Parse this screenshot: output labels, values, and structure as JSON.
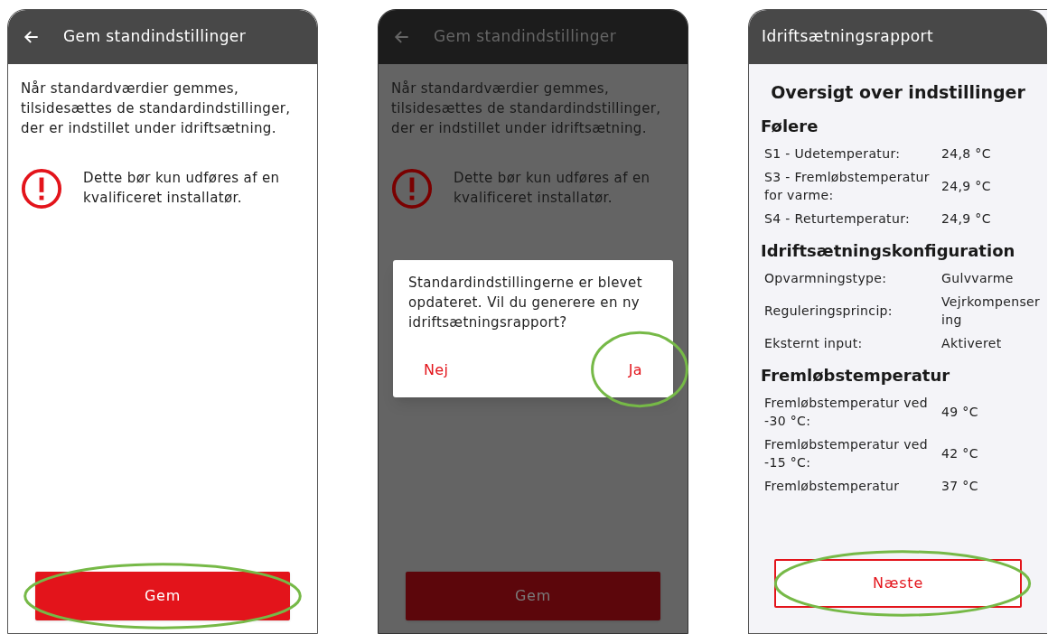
{
  "screens": [
    {
      "kind": "save",
      "dimmed": false,
      "title": "Gem standindstillinger",
      "intro": "Når standardværdier gemmes, tilsidesættes de standardindstillinger, der er indstillet under idriftsætning.",
      "warning": "Dette bør kun udføres af en kvalificeret installatør.",
      "button": {
        "label": "Gem",
        "highlighted": true
      }
    },
    {
      "kind": "save",
      "dimmed": true,
      "title": "Gem standindstillinger",
      "intro": "Når standardværdier gemmes, tilsidesættes de standardindstillinger, der er indstillet under idriftsætning.",
      "warning": "Dette bør kun udføres af en kvalificeret installatør.",
      "button": {
        "label": "Gem",
        "highlighted": false
      },
      "dialog": {
        "message": "Standardindstillingerne er blevet opdateret. Vil du generere en ny idriftsætningsrapport?",
        "buttons": [
          {
            "label": "Nej",
            "highlighted": false
          },
          {
            "label": "Ja",
            "highlighted": true
          }
        ]
      }
    },
    {
      "kind": "report",
      "title": "Idriftsætningsrapport",
      "heading": "Oversigt over indstillinger",
      "sections": [
        {
          "title": "Følere",
          "rows": [
            {
              "label": "S1 - Udetemperatur:",
              "value": "24,8 °C"
            },
            {
              "label": "S3 - Fremløbstemperatur for varme:",
              "value": "24,9 °C"
            },
            {
              "label": "S4 - Returtemperatur:",
              "value": "24,9 °C"
            }
          ]
        },
        {
          "title": "Idriftsætningskonfiguration",
          "rows": [
            {
              "label": "Opvarmningstype:",
              "value": "Gulvvarme"
            },
            {
              "label": "Reguleringsprincip:",
              "value": "Vejrkompensering"
            },
            {
              "label": "Eksternt input:",
              "value": "Aktiveret"
            }
          ]
        },
        {
          "title": "Fremløbstemperatur",
          "rows": [
            {
              "label": "Fremløbstemperatur ved -30 °C:",
              "value": "49 °C"
            },
            {
              "label": "Fremløbstemperatur ved -15 °C:",
              "value": "42 °C"
            },
            {
              "label": "Fremløbstemperatur",
              "value": "37 °C"
            }
          ]
        }
      ],
      "button": {
        "label": "Næste",
        "highlighted": true
      }
    }
  ]
}
